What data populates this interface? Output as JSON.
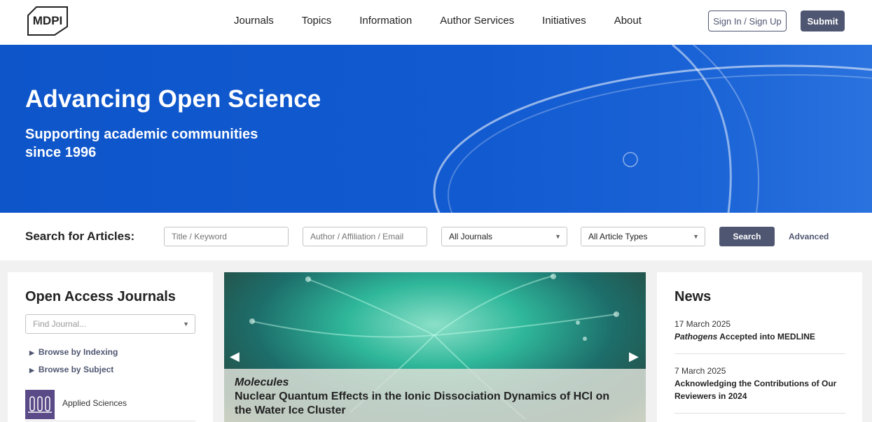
{
  "header": {
    "logo_text": "MDPI",
    "nav": [
      "Journals",
      "Topics",
      "Information",
      "Author Services",
      "Initiatives",
      "About"
    ],
    "signin_label": "Sign In / Sign Up",
    "submit_label": "Submit"
  },
  "hero": {
    "title": "Advancing Open Science",
    "subtitle": "Supporting academic communities since 1996"
  },
  "search": {
    "label": "Search for Articles:",
    "keyword_placeholder": "Title / Keyword",
    "author_placeholder": "Author / Affiliation / Email",
    "journals_value": "All Journals",
    "types_value": "All Article Types",
    "button_label": "Search",
    "advanced_label": "Advanced"
  },
  "journals_panel": {
    "title": "Open Access Journals",
    "find_placeholder": "Find Journal...",
    "browse_indexing": "Browse by Indexing",
    "browse_subject": "Browse by Subject",
    "first_journal": "Applied Sciences"
  },
  "carousel": {
    "journal": "Molecules",
    "title": "Nuclear Quantum Effects in the Ionic Dissociation Dynamics of HCl on the Water Ice Cluster"
  },
  "news": {
    "title": "News",
    "items": [
      {
        "date": "17 March 2025",
        "title_italic": "Pathogens",
        "title_rest": " Accepted into MEDLINE"
      },
      {
        "date": "7 March 2025",
        "title": "Acknowledging the Contributions of Our Reviewers in 2024"
      }
    ]
  },
  "colors": {
    "brand_dark": "#4f5671",
    "hero_blue": "#125ad0"
  }
}
